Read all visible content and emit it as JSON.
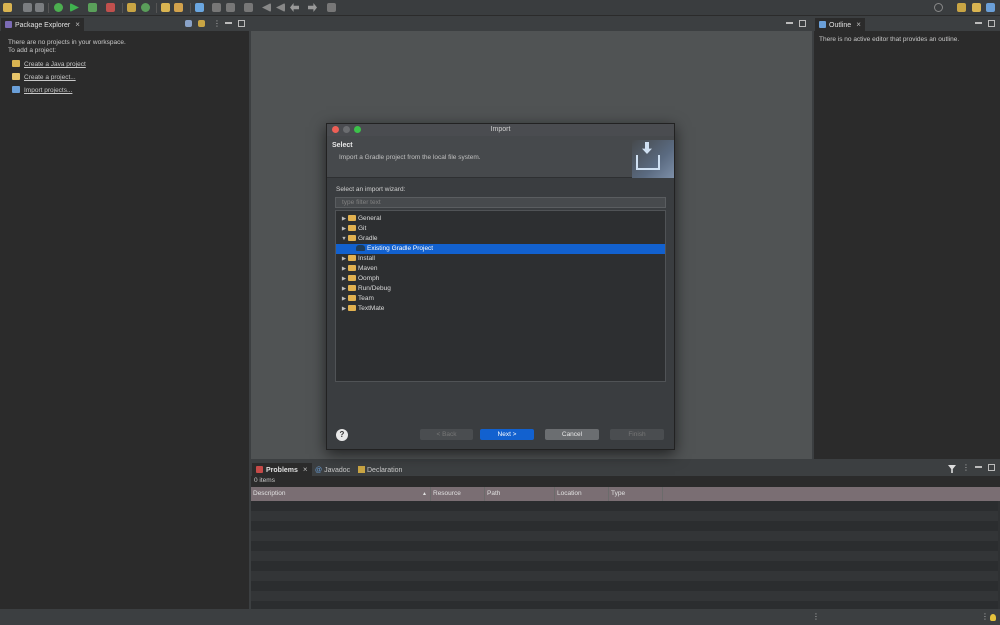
{
  "package_explorer": {
    "tab_label": "Package Explorer",
    "message_line1": "There are no projects in your workspace.",
    "message_line2": "To add a project:",
    "links": [
      "Create a Java project",
      "Create a project...",
      "Import projects..."
    ]
  },
  "outline": {
    "tab_label": "Outline",
    "message": "There is no active editor that provides an outline."
  },
  "dialog": {
    "title": "Import",
    "header_title": "Select",
    "header_desc": "Import a Gradle project from the local file system.",
    "wizard_label": "Select an import wizard:",
    "filter_placeholder": "type filter text",
    "tree": [
      {
        "label": "General",
        "expanded": false,
        "selected": false
      },
      {
        "label": "Git",
        "expanded": false,
        "selected": false
      },
      {
        "label": "Gradle",
        "expanded": true,
        "selected": false
      },
      {
        "label": "Existing Gradle Project",
        "child": true,
        "selected": true
      },
      {
        "label": "Install",
        "expanded": false,
        "selected": false
      },
      {
        "label": "Maven",
        "expanded": false,
        "selected": false
      },
      {
        "label": "Oomph",
        "expanded": false,
        "selected": false
      },
      {
        "label": "Run/Debug",
        "expanded": false,
        "selected": false
      },
      {
        "label": "Team",
        "expanded": false,
        "selected": false
      },
      {
        "label": "TextMate",
        "expanded": false,
        "selected": false
      }
    ],
    "buttons": {
      "back": "< Back",
      "next": "Next >",
      "cancel": "Cancel",
      "finish": "Finish"
    }
  },
  "bottom": {
    "tabs": [
      "Problems",
      "Javadoc",
      "Declaration"
    ],
    "item_count": "0 items",
    "columns": [
      "Description",
      "Resource",
      "Path",
      "Location",
      "Type"
    ]
  },
  "colors": {
    "accent": "#1261cf",
    "folder": "#e2b14f"
  }
}
